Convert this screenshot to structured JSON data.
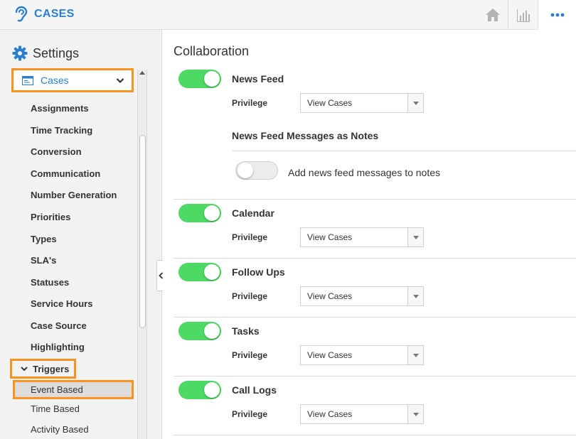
{
  "header": {
    "title": "CASES"
  },
  "icons": {
    "brand": "ear-icon",
    "home": "home-icon",
    "reports": "bar-chart-icon",
    "more": "more-dots-icon",
    "settings": "gear-icon",
    "module": "window-icon"
  },
  "colors": {
    "accent": "#2a7ed1",
    "highlight": "#f7931e",
    "toggle_on": "#4cd964"
  },
  "sidebar": {
    "title": "Settings",
    "module": "Cases",
    "items": [
      "Assignments",
      "Time Tracking",
      "Conversion",
      "Communication",
      "Number Generation",
      "Priorities",
      "Types",
      "SLA's",
      "Statuses",
      "Service Hours",
      "Case Source",
      "Highlighting"
    ],
    "triggers": {
      "label": "Triggers",
      "expanded": true,
      "sub_items": [
        "Event Based",
        "Time Based",
        "Activity Based"
      ],
      "selected": "Event Based"
    }
  },
  "main": {
    "section_title": "Collaboration",
    "privilege_label": "Privilege",
    "features": [
      {
        "title": "News Feed",
        "enabled": true,
        "privilege": "View Cases"
      },
      {
        "title": "Calendar",
        "enabled": true,
        "privilege": "View Cases"
      },
      {
        "title": "Follow Ups",
        "enabled": true,
        "privilege": "View Cases"
      },
      {
        "title": "Tasks",
        "enabled": true,
        "privilege": "View Cases"
      },
      {
        "title": "Call Logs",
        "enabled": true,
        "privilege": "View Cases"
      }
    ],
    "notes_option": {
      "title": "News Feed Messages as Notes",
      "label": "Add news feed messages to notes",
      "enabled": false
    }
  }
}
